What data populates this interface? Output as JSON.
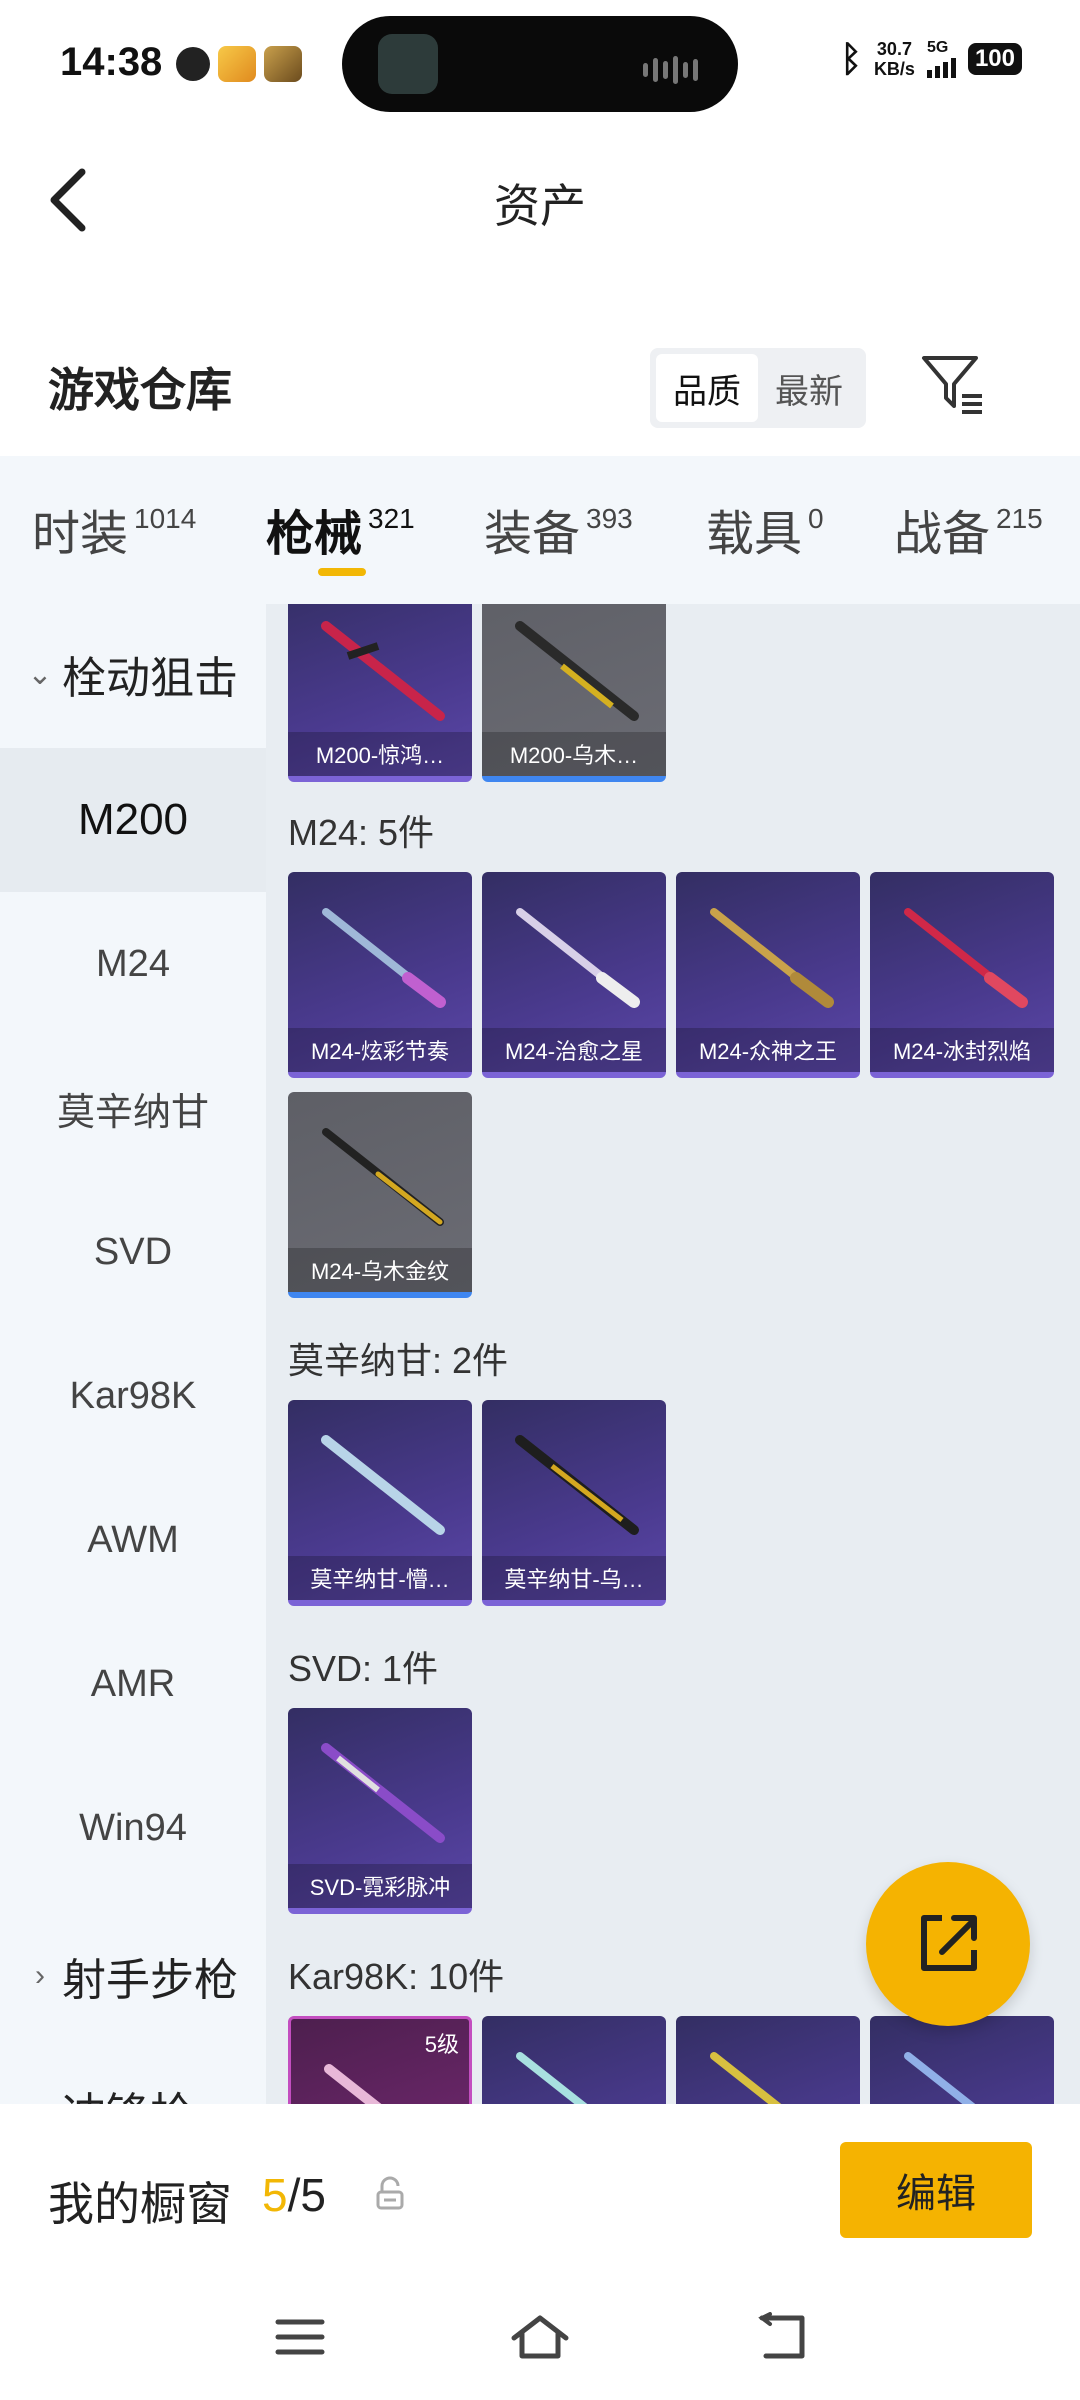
{
  "status_bar": {
    "time": "14:38",
    "net_speed_value": "30.7",
    "net_speed_unit": "KB/s",
    "network": "5G",
    "battery": "100"
  },
  "header": {
    "title": "资产"
  },
  "repo": {
    "title": "游戏仓库",
    "sort_options": [
      "品质",
      "最新"
    ],
    "sort_selected": "品质"
  },
  "tabs": [
    {
      "label": "时装",
      "count": "1014"
    },
    {
      "label": "枪械",
      "count": "321"
    },
    {
      "label": "装备",
      "count": "393"
    },
    {
      "label": "载具",
      "count": "0"
    },
    {
      "label": "战备",
      "count": "215"
    }
  ],
  "active_tab": "枪械",
  "sidebar": {
    "group_expanded": "栓动狙击",
    "items": [
      "M200",
      "M24",
      "莫辛纳甘",
      "SVD",
      "Kar98K",
      "AWM",
      "AMR",
      "Win94"
    ],
    "active_item": "M200",
    "group_collapsed": "射手步枪",
    "group_cut": "冲锋枪"
  },
  "sections": {
    "m200": {
      "cards": [
        "M200-惊鸿…",
        "M200-乌木…"
      ]
    },
    "m24": {
      "title": "M24: 5件",
      "cards": [
        "M24-炫彩节奏",
        "M24-治愈之星",
        "M24-众神之王",
        "M24-冰封烈焰",
        "M24-乌木金纹"
      ]
    },
    "mosin": {
      "title": "莫辛纳甘: 2件",
      "cards": [
        "莫辛纳甘-懵…",
        "莫辛纳甘-乌…"
      ]
    },
    "svd": {
      "title": "SVD: 1件",
      "cards": [
        "SVD-霓彩脉冲"
      ]
    },
    "kar98k": {
      "title": "Kar98K: 10件",
      "first_level": "5级"
    }
  },
  "showcase": {
    "label": "我的橱窗",
    "count_current": "5",
    "count_total": "/5",
    "edit_label": "编辑"
  },
  "colors": {
    "accent": "#f5b301",
    "purple_card": "#4a3a8e",
    "gray_card": "#6b6c74",
    "blue_rarity": "#3f86f0"
  },
  "icons": [
    "back-arrow-icon",
    "filter-icon",
    "share-icon",
    "lock-icon",
    "menu-icon",
    "home-icon",
    "back-nav-icon"
  ]
}
